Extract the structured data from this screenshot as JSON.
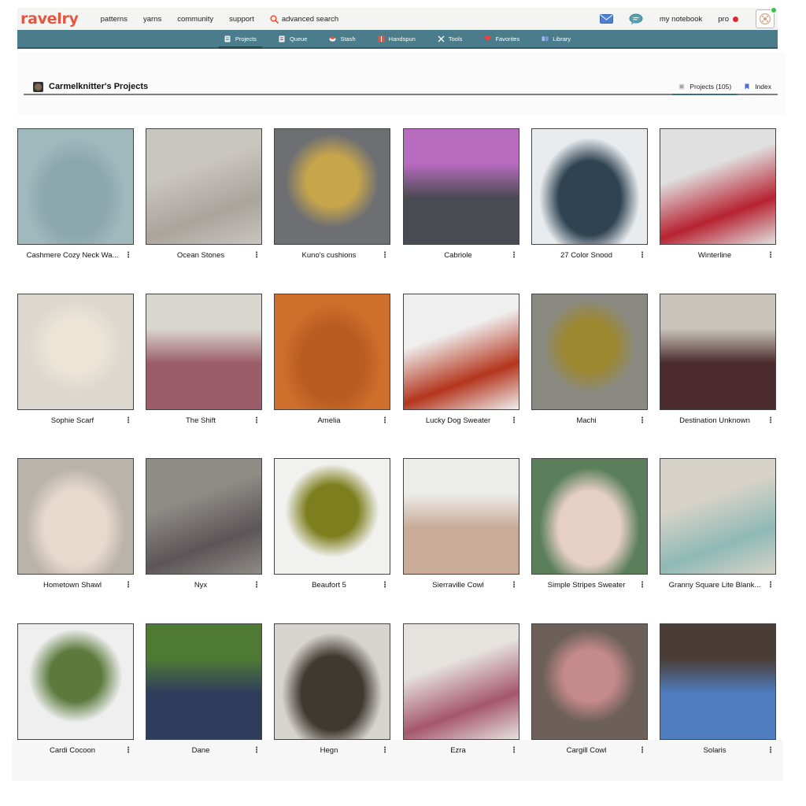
{
  "brand": {
    "logo": "ravelry"
  },
  "top_nav": {
    "links": [
      "patterns",
      "yarns",
      "community",
      "support"
    ],
    "advanced_search": "advanced search",
    "my_notebook": "my notebook",
    "pro": "pro"
  },
  "sub_nav": {
    "items": [
      {
        "label": "Projects",
        "icon": "projects-icon",
        "active": true
      },
      {
        "label": "Queue",
        "icon": "queue-icon",
        "active": false
      },
      {
        "label": "Stash",
        "icon": "stash-icon",
        "active": false
      },
      {
        "label": "Handspun",
        "icon": "handspun-icon",
        "active": false
      },
      {
        "label": "Tools",
        "icon": "tools-icon",
        "active": false
      },
      {
        "label": "Favorites",
        "icon": "heart-icon",
        "active": false
      },
      {
        "label": "Library",
        "icon": "library-icon",
        "active": false
      }
    ]
  },
  "page": {
    "title": "Carmelknitter's Projects",
    "tabs": [
      {
        "label": "Projects (105)",
        "active": true
      },
      {
        "label": "Index",
        "active": false
      }
    ]
  },
  "colors": {
    "brand": "#e4563f",
    "subnav": "#4b7c8c",
    "status_dot": "#e0262e",
    "online": "#35c44a"
  },
  "projects": [
    {
      "name": "Cashmere Cozy Neck Wa...",
      "colors": [
        "#9fb9bd",
        "#8aa7ab"
      ]
    },
    {
      "name": "Ocean Stones",
      "colors": [
        "#c9c5bf",
        "#a9a49c"
      ]
    },
    {
      "name": "Kuno's cushions",
      "colors": [
        "#6d6f73",
        "#c7a54b"
      ]
    },
    {
      "name": "Cabriole",
      "colors": [
        "#b76cc0",
        "#4a4a52"
      ]
    },
    {
      "name": "27 Color Snood",
      "colors": [
        "#e8ecef",
        "#2f4352"
      ]
    },
    {
      "name": "Winterline",
      "colors": [
        "#e0e0e0",
        "#b72231"
      ]
    },
    {
      "name": "Sophie Scarf",
      "colors": [
        "#dcd8d0",
        "#ece5d6"
      ]
    },
    {
      "name": "The Shift",
      "colors": [
        "#d9d5cf",
        "#9b5d6a"
      ]
    },
    {
      "name": "Amelia",
      "colors": [
        "#cf6f2c",
        "#b85c22"
      ]
    },
    {
      "name": "Lucky Dog Sweater",
      "colors": [
        "#efefef",
        "#b4351d"
      ]
    },
    {
      "name": "Machi",
      "colors": [
        "#8a8a82",
        "#9c8731"
      ]
    },
    {
      "name": "Destination Unknown",
      "colors": [
        "#c9c3bb",
        "#4a2a2c"
      ]
    },
    {
      "name": "Hometown Shawl",
      "colors": [
        "#b9b3aa",
        "#e8d9cd"
      ]
    },
    {
      "name": "Nyx",
      "colors": [
        "#8f8c86",
        "#5b5558"
      ]
    },
    {
      "name": "Beaufort 5",
      "colors": [
        "#f1f1ef",
        "#7d7e1d"
      ]
    },
    {
      "name": "Sierraville Cowl",
      "colors": [
        "#ececea",
        "#c9ab97"
      ]
    },
    {
      "name": "Simple Stripes Sweater",
      "colors": [
        "#5a7f5a",
        "#e6cfc5"
      ]
    },
    {
      "name": "Granny Square Lite Blank...",
      "colors": [
        "#d8d3c9",
        "#8fb9b5"
      ]
    },
    {
      "name": "Cardi Cocoon",
      "colors": [
        "#efefef",
        "#5b7a3c"
      ]
    },
    {
      "name": "Dane",
      "colors": [
        "#4f7a34",
        "#2f3d5c"
      ]
    },
    {
      "name": "Hegn",
      "colors": [
        "#d7d4cf",
        "#3f3a31"
      ]
    },
    {
      "name": "Ezra",
      "colors": [
        "#e6e3df",
        "#a5566e"
      ]
    },
    {
      "name": "Cargill Cowl",
      "colors": [
        "#6d6058",
        "#c58a8a"
      ]
    },
    {
      "name": "Solaris",
      "colors": [
        "#4a3d35",
        "#4f7dc0"
      ]
    }
  ]
}
